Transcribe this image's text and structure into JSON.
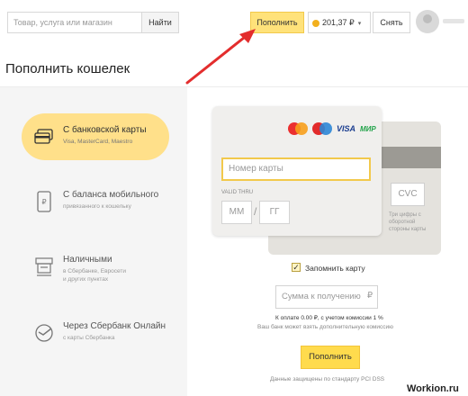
{
  "header": {
    "search_placeholder": "Товар, услуга или магазин",
    "search_button": "Найти",
    "topup_button": "Пополнить",
    "balance": "201,37 ₽",
    "withdraw_button": "Снять"
  },
  "page": {
    "title": "Пополнить кошелек"
  },
  "payment_methods": [
    {
      "title": "С банковской карты",
      "subtitle": "Visa, MasterCard, Maestro",
      "icon": "bank-card-icon",
      "active": true
    },
    {
      "title": "С баланса мобильного",
      "subtitle": "привязанного к кошельку",
      "icon": "mobile-phone-icon",
      "active": false
    },
    {
      "title": "Наличными",
      "subtitle": "в Сбербанке, Евросети",
      "subtitle2": "и других пунктах",
      "icon": "cash-terminal-icon",
      "active": false
    },
    {
      "title": "Через Сбербанк Онлайн",
      "subtitle": "с карты Сбербанка",
      "icon": "sberbank-icon",
      "active": false
    }
  ],
  "card_form": {
    "brands": {
      "visa": "VISA",
      "mir": "МИР"
    },
    "card_number_placeholder": "Номер карты",
    "valid_thru_label": "VALID THRU",
    "month_placeholder": "ММ",
    "year_placeholder": "ГГ",
    "cvc_placeholder": "CVC",
    "cvc_hint": "Три цифры с оборотной стороны карты"
  },
  "remember_card": {
    "label": "Запомнить карту",
    "checked": true
  },
  "amount": {
    "placeholder": "Сумма к получению",
    "currency": "₽",
    "fee_text": "К оплате 0.00 ₽, с учетом комиссии 1 %",
    "bank_fee_text": "Ваш банк может взять дополнительную комиссию"
  },
  "pay_button": "Пополнить",
  "secure_text": "Данные защищены по стандарту PCI DSS",
  "watermark": "Workion.ru",
  "colors": {
    "accent_yellow": "#ffdb4d",
    "active_method_bg": "#ffe08a",
    "arrow_red": "#e32d2d"
  }
}
